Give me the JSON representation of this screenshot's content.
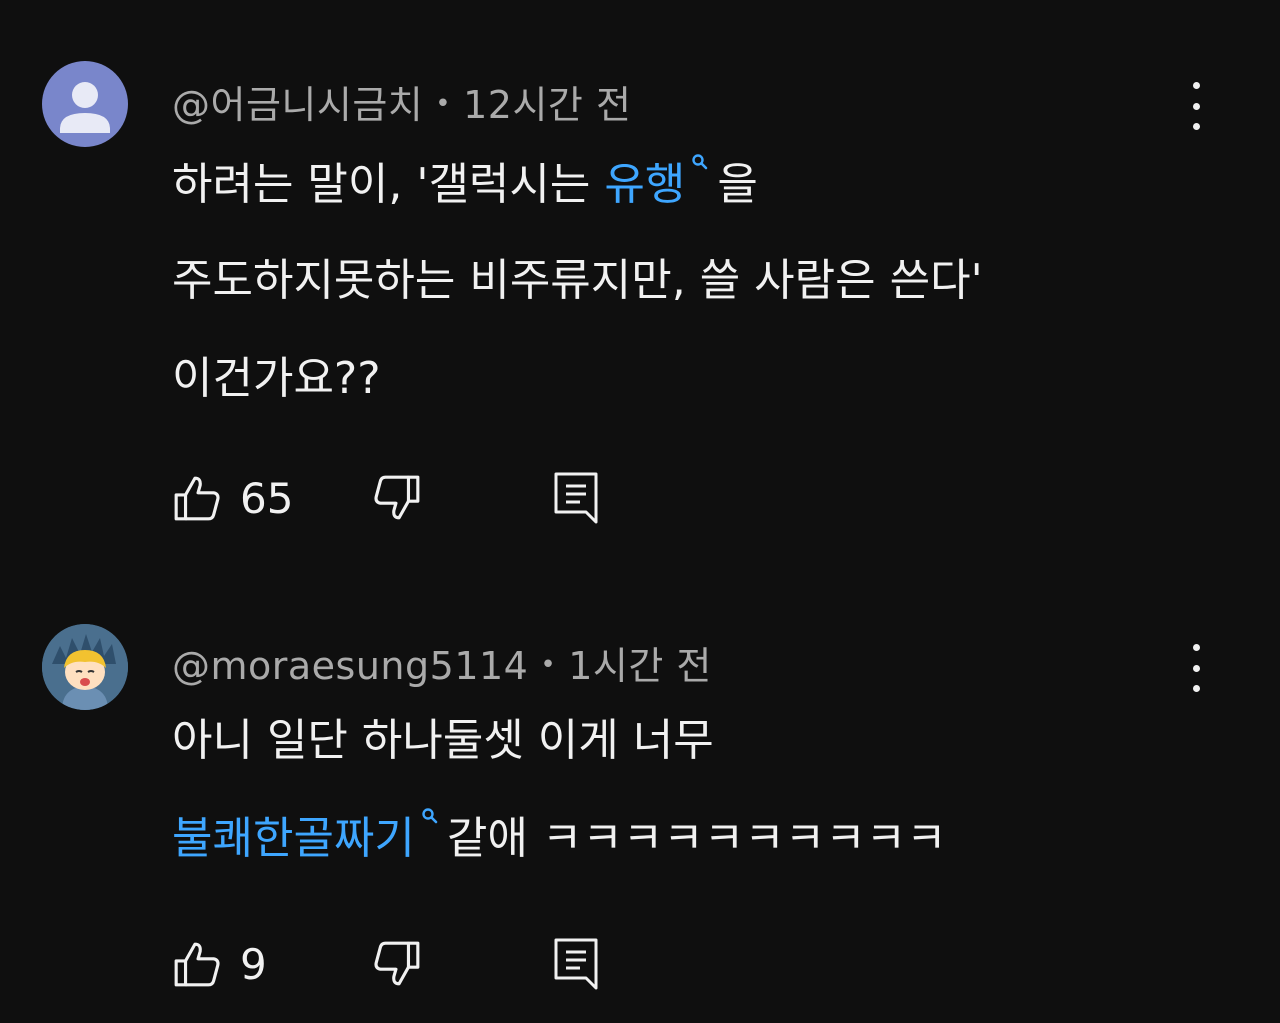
{
  "comments": [
    {
      "author": "@어금니시금치",
      "time": "12시간 전",
      "lines": [
        {
          "before": "하려는 말이, '갤럭시는 ",
          "link": "유행",
          "after": "을"
        },
        {
          "before": "주도하지못하는 비주류지만, 쓸 사람은 쓴다'",
          "link": "",
          "after": ""
        },
        {
          "before": "이건가요??",
          "link": "",
          "after": ""
        }
      ],
      "likes": "65"
    },
    {
      "author": "@moraesung5114",
      "time": "1시간 전",
      "lines": [
        {
          "before": "아니 일단 하나둘셋 이게 너무",
          "link": "",
          "after": ""
        },
        {
          "before": "",
          "link": "불쾌한골짜기",
          "after": "같애 ㅋㅋㅋㅋㅋㅋㅋㅋㅋㅋ"
        }
      ],
      "likes": "9"
    }
  ],
  "icons": {
    "more": "vertical-ellipsis-icon",
    "like": "thumb-up-icon",
    "dislike": "thumb-down-icon",
    "reply": "reply-comment-icon",
    "link_search": "search-icon"
  },
  "colors": {
    "background": "#0f0f0f",
    "text": "#f1f1f1",
    "meta": "#aaaaaa",
    "link": "#3ea6ff"
  }
}
